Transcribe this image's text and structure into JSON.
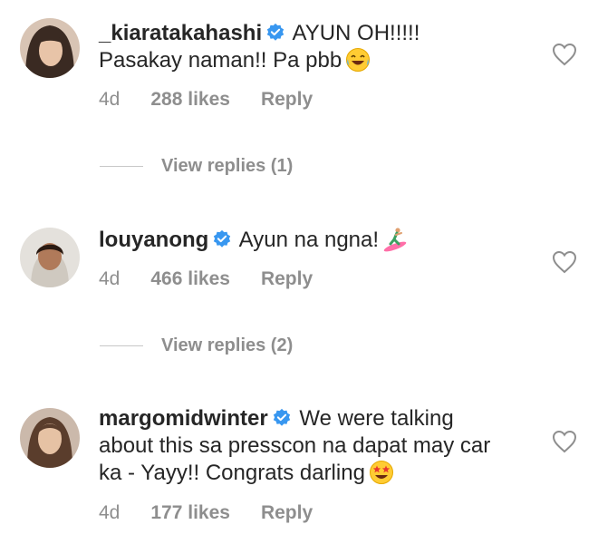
{
  "comments": [
    {
      "username": "_kiaratakahashi",
      "text": "AYUN OH!!!!! Pasakay naman!! Pa pbb",
      "emoji": "face-with-tears-of-joy-icon",
      "time": "4d",
      "likes": "288 likes",
      "reply": "Reply"
    },
    {
      "username": "louyanong",
      "text": "Ayun na ngna!",
      "emoji": "person-surfing-icon",
      "time": "4d",
      "likes": "466 likes",
      "reply": "Reply"
    },
    {
      "username": "margomidwinter",
      "text": "We were talking about this sa presscon na dapat may car ka - Yayy!! Congrats darling",
      "emoji": "star-struck-icon",
      "time": "4d",
      "likes": "177 likes",
      "reply": "Reply"
    }
  ],
  "view_replies": [
    "View replies (1)",
    "View replies (2)"
  ],
  "colors": {
    "text": "#262626",
    "muted": "#8e8e8e",
    "verified": "#3897f0"
  }
}
